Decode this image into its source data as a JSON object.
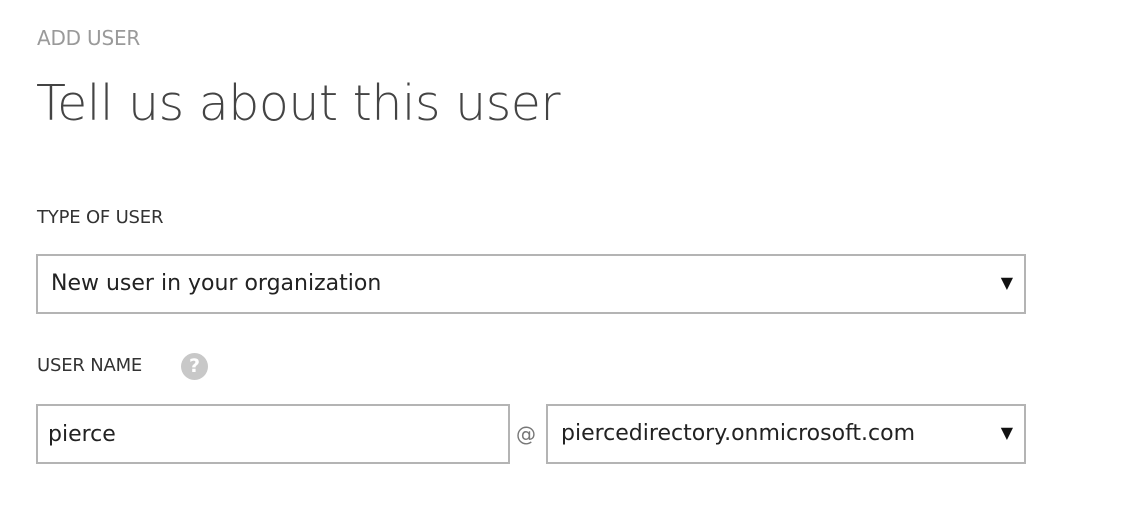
{
  "header": {
    "eyebrow": "ADD USER",
    "title": "Tell us about this user"
  },
  "type_of_user": {
    "label": "TYPE OF USER",
    "selected": "New user in your organization",
    "dropdown_icon": "triangle-down-icon"
  },
  "user_name": {
    "label": "USER NAME",
    "help_icon": "question-mark-icon",
    "help_glyph": "?",
    "value": "pierce",
    "separator": "@",
    "domain_selected": "piercedirectory.onmicrosoft.com",
    "dropdown_icon": "triangle-down-icon"
  },
  "colors": {
    "border": "#b4b4b4",
    "muted_text": "#9a9a9a",
    "help_icon_bg": "#c8c8c8"
  }
}
